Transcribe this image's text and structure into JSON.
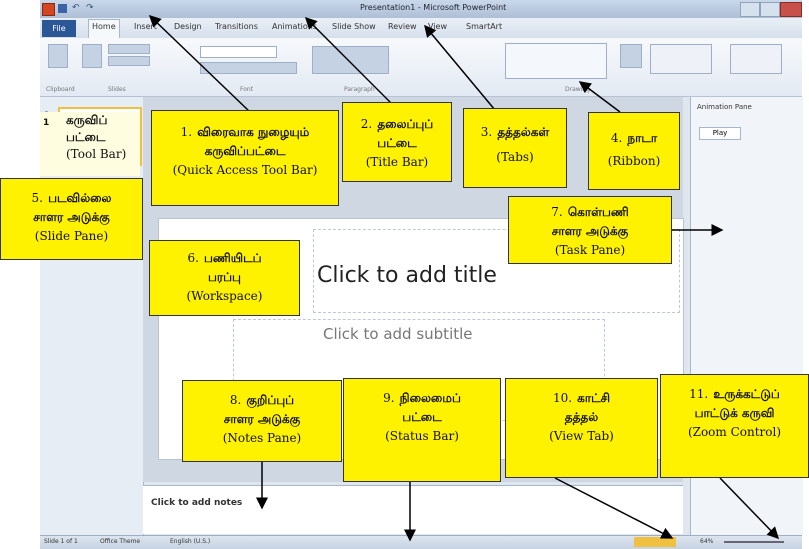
{
  "window": {
    "title": "Presentation1 - Microsoft PowerPoint",
    "tabs": [
      "File",
      "Home",
      "Insert",
      "Design",
      "Transitions",
      "Animations",
      "Slide Show",
      "Review",
      "View",
      "SmartArt"
    ],
    "ribbon_groups": [
      "Clipboard",
      "Slides",
      "Font",
      "Paragraph",
      "Drawing"
    ],
    "task_pane_title": "Animation Pane",
    "task_pane_button": "Play",
    "thumb_number": "1",
    "slide_title_placeholder": "Click to add title",
    "slide_subtitle_placeholder": "Click to add subtitle",
    "notes_placeholder": "Click to add notes",
    "status_left": "Slide 1 of 1",
    "status_theme": "Office Theme",
    "status_lang": "English (U.S.)",
    "zoom_label": "64%"
  },
  "callouts": {
    "toolbar": {
      "tamil": [
        "கருவிப்",
        "பட்டை"
      ],
      "english": "(Tool Bar)",
      "number": "1"
    },
    "quick_access": {
      "number": "1.",
      "tamil": [
        "விரைவாக நுழையும்",
        "கருவிப்பட்டை"
      ],
      "english": "(Quick Access Tool Bar)"
    },
    "title_bar": {
      "number": "2.",
      "tamil": [
        "தலைப்புப்",
        "பட்டை"
      ],
      "english": "(Title Bar)"
    },
    "tabs": {
      "number": "3.",
      "tamil": [
        "தத்தல்கள்"
      ],
      "english": "(Tabs)"
    },
    "ribbon": {
      "number": "4.",
      "tamil": [
        "நாடா"
      ],
      "english": "(Ribbon)"
    },
    "slide_pane": {
      "number": "5.",
      "tamil": [
        "படவில்லை",
        "சாளர அடுக்கு"
      ],
      "english": "(Slide Pane)"
    },
    "workspace": {
      "number": "6.",
      "tamil": [
        "பணியிடப்",
        "பரப்பு"
      ],
      "english": "(Workspace)"
    },
    "task_pane": {
      "number": "7.",
      "tamil": [
        "கொள்பணி",
        "சாளர அடுக்கு"
      ],
      "english": "(Task Pane)"
    },
    "notes_pane": {
      "number": "8.",
      "tamil": [
        "குறிப்புப்",
        "சாளர அடுக்கு"
      ],
      "english": "(Notes Pane)"
    },
    "status_bar": {
      "number": "9.",
      "tamil": [
        "நிலைமைப்",
        "பட்டை"
      ],
      "english": "(Status Bar)"
    },
    "view_tab": {
      "number": "10.",
      "tamil": [
        "காட்சி",
        "தத்தல்"
      ],
      "english": "(View Tab)"
    },
    "zoom_control": {
      "number": "11.",
      "tamil": [
        "உருக்கட்டுப்",
        "பாட்டுக் கருவி"
      ],
      "english": "(Zoom Control)"
    }
  },
  "colors": {
    "callout_bg": "#fff200",
    "accent": "#2b5797",
    "arrow": "#000000"
  }
}
